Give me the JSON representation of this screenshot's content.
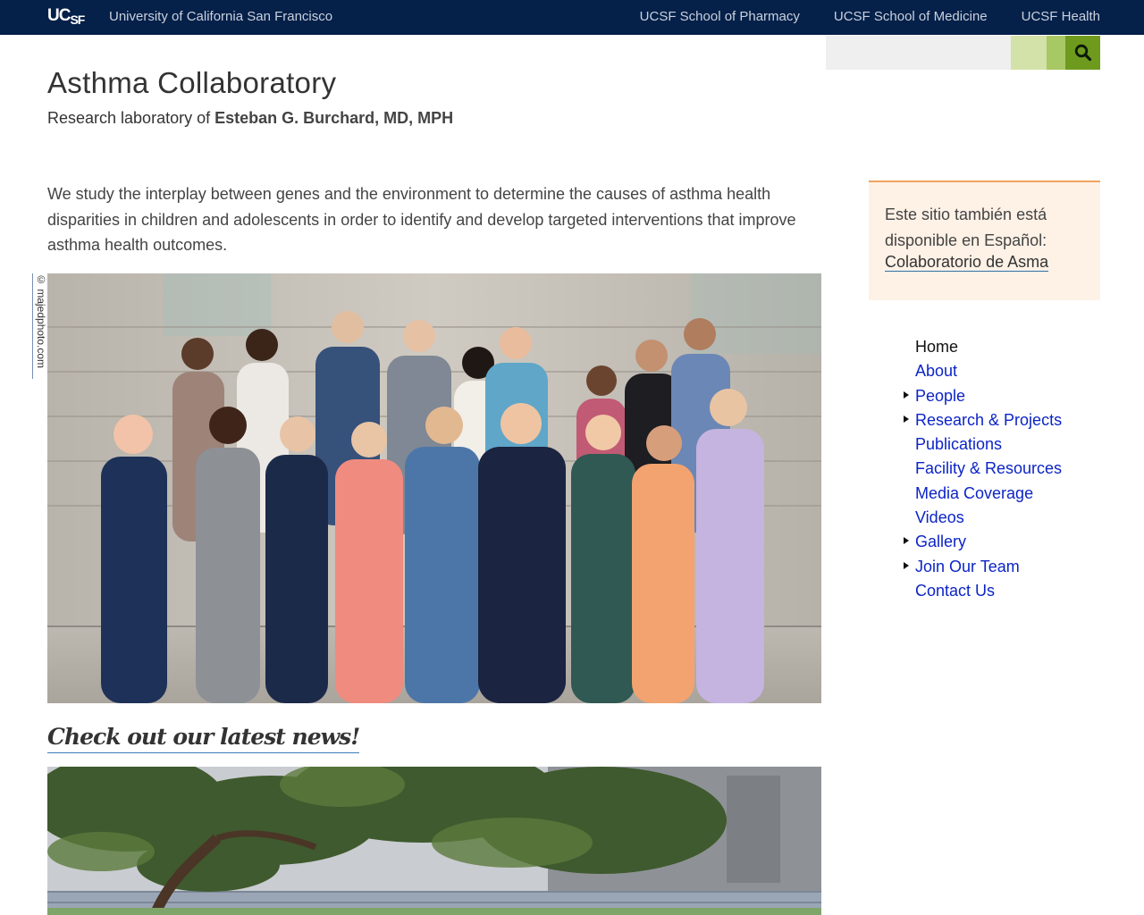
{
  "topbar": {
    "logo_primary": "UC",
    "logo_secondary": "SF",
    "university": "University of California San Francisco",
    "links": [
      {
        "label": "UCSF School of Pharmacy"
      },
      {
        "label": "UCSF School of Medicine"
      },
      {
        "label": "UCSF Health"
      }
    ]
  },
  "search": {
    "placeholder": "",
    "button_icon": "search-icon"
  },
  "header": {
    "title": "Asthma Collaboratory",
    "subtitle_prefix": "Research laboratory of",
    "subtitle_name": "Esteban G. Burchard, MD, MPH"
  },
  "intro": {
    "text": "We study the interplay between genes and the environment to determine the causes of asthma health disparities in children and adolescents in order to identify and develop targeted interventions that improve asthma health outcomes."
  },
  "photo": {
    "credit": "© majedphoto.com"
  },
  "news": {
    "heading": "Check out our latest news!"
  },
  "espanol": {
    "text": "Este sitio también está disponible en Español:",
    "link": "Colaboratorio de Asma"
  },
  "nav": {
    "items": [
      {
        "label": "Home",
        "active": true,
        "expandable": false
      },
      {
        "label": "About",
        "active": false,
        "expandable": false
      },
      {
        "label": "People",
        "active": false,
        "expandable": true
      },
      {
        "label": "Research & Projects",
        "active": false,
        "expandable": true
      },
      {
        "label": "Publications",
        "active": false,
        "expandable": false
      },
      {
        "label": "Facility & Resources",
        "active": false,
        "expandable": false
      },
      {
        "label": "Media Coverage",
        "active": false,
        "expandable": false
      },
      {
        "label": "Videos",
        "active": false,
        "expandable": false
      },
      {
        "label": "Gallery",
        "active": false,
        "expandable": true
      },
      {
        "label": "Join Our Team",
        "active": false,
        "expandable": true
      },
      {
        "label": "Contact Us",
        "active": false,
        "expandable": false
      }
    ]
  },
  "colors": {
    "topbar": "#052049",
    "link": "#0c24c6",
    "search_button": "#6e9a1e",
    "espanol_bg": "#fef1e6",
    "espanol_border": "#f0a35e"
  }
}
